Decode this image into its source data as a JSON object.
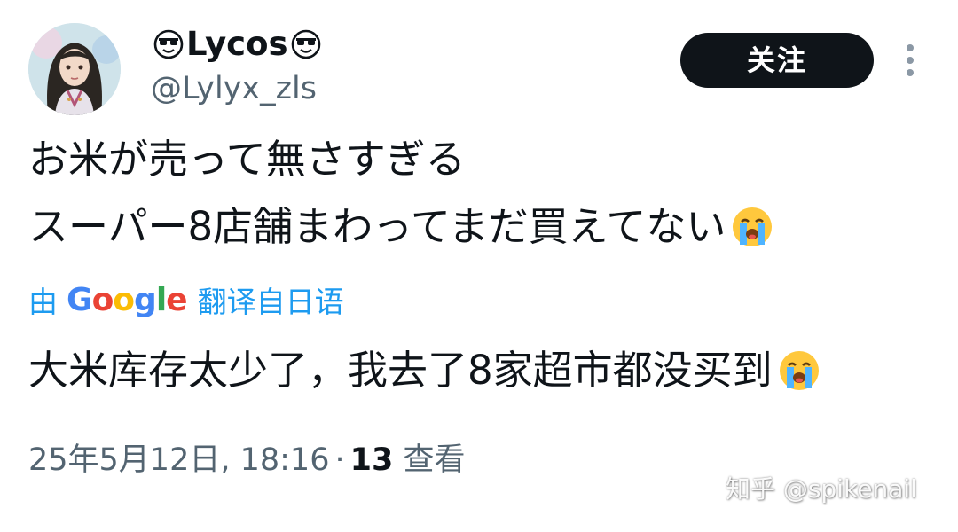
{
  "tweet": {
    "author": {
      "display_name": "Lycos",
      "name_prefix_icon": "smiling-face-with-sunglasses-icon",
      "name_suffix_icon": "smiling-face-with-sunglasses-icon",
      "handle": "@Lylyx_zls",
      "avatar": "avatar-girl-icon"
    },
    "follow_label": "关注",
    "more_icon": "more-vertical-icon",
    "text_lines": [
      "お米が売って無さすぎる",
      "スーパー8店舗まわってまだ買えてない"
    ],
    "text_emoji": "loudly-crying-face-icon",
    "translation": {
      "by": "由",
      "provider": "Google",
      "provider_letters": [
        "G",
        "o",
        "o",
        "g",
        "l",
        "e"
      ],
      "from": "翻译自日语",
      "text": "大米库存太少了，我去了8家超市都没买到"
    },
    "meta": {
      "timestamp": "25年5月12日, 18:16",
      "separator": "·",
      "views_count": "13",
      "views_label": "查看"
    }
  },
  "watermark": "知乎 @spikenail",
  "colors": {
    "text": "#0f1419",
    "secondary": "#536471",
    "link": "#1d9bf0",
    "button_bg": "#0f1419",
    "button_text": "#ffffff",
    "divider": "#cfd9de"
  }
}
